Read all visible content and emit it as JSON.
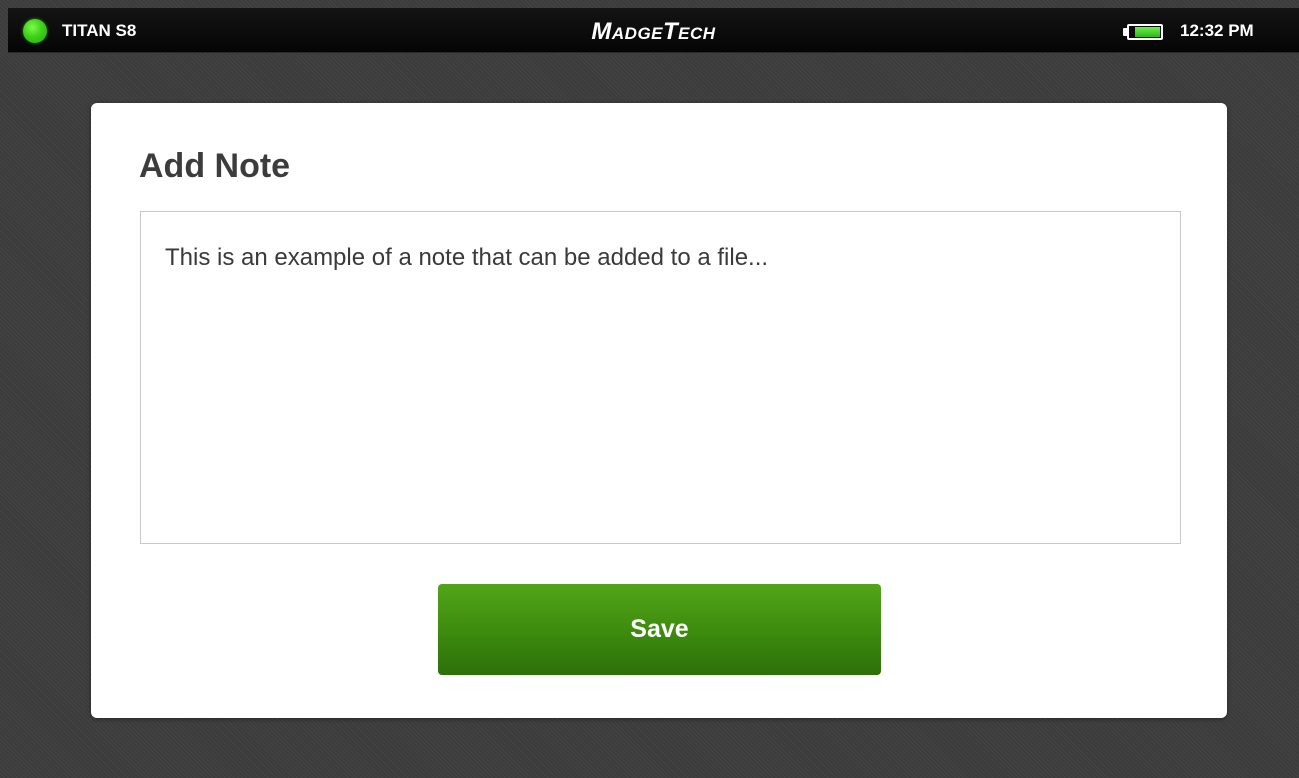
{
  "status_bar": {
    "device_name": "TITAN S8",
    "brand": "MadgeTech",
    "time": "12:32 PM",
    "battery_level": 0.85,
    "status_led_color": "#3ed11a",
    "battery_color": "#3ccf20"
  },
  "dialog": {
    "title": "Add Note",
    "note_text": "This is an example of a note that can be added to a file...",
    "save_label": "Save",
    "save_color": "#3c8a0e"
  },
  "icons": {
    "status": "status-led-icon",
    "battery": "battery-icon"
  }
}
